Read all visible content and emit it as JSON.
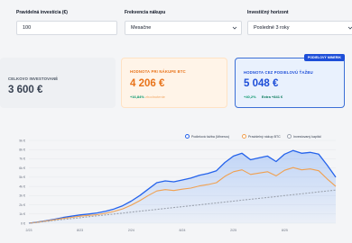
{
  "controls": {
    "investment": {
      "label": "Pravidelná investícia (€)",
      "value": "100"
    },
    "frequency": {
      "label": "Frekvencia nákupu",
      "value": "Mesačne"
    },
    "period": {
      "label": "Investičný horizont",
      "value": "Posledné 3 roky"
    }
  },
  "cards": {
    "total": {
      "title": "CELKOVO INVESTOVANÉ",
      "value": "3 600 €"
    },
    "btc": {
      "title": "HODNOTA PRI NÁKUPE BTC",
      "value": "4 206 €",
      "change": "+16,84%",
      "note": "zhodnotenie"
    },
    "mining": {
      "title": "HODNOTA CEZ PODIELOVÚ ŤAŽBU",
      "badge": "PODIELOVÝ MINERIK",
      "value": "5 048 €",
      "change": "+40,2%",
      "extra": "Extra +841 €"
    }
  },
  "chart_data": {
    "type": "line",
    "x_tick_labels": [
      "2/23",
      "8/23",
      "2/24",
      "8/24",
      "2/25",
      "8/25"
    ],
    "y_tick_labels": [
      "0 €",
      "1k €",
      "2k €",
      "3k €",
      "4k €",
      "5k €",
      "6k €",
      "7k €",
      "8k €",
      "9k €"
    ],
    "ylim": [
      0,
      9000
    ],
    "grid": true,
    "legend_position": "top-right",
    "x_months": [
      0,
      1,
      2,
      3,
      4,
      5,
      6,
      7,
      8,
      9,
      10,
      11,
      12,
      13,
      14,
      15,
      16,
      17,
      18,
      19,
      20,
      21,
      22,
      23,
      24,
      25,
      26,
      27,
      28,
      29,
      30,
      31,
      32,
      33,
      34,
      35,
      36
    ],
    "series": [
      {
        "name": "Podielová ťažba (Minerus)",
        "color": "#2563eb",
        "fill": true,
        "values": [
          0,
          120,
          260,
          430,
          620,
          760,
          900,
          1000,
          1120,
          1300,
          1550,
          1900,
          2400,
          3000,
          3700,
          4400,
          4600,
          4500,
          4700,
          4900,
          5200,
          5400,
          5700,
          6600,
          7300,
          7600,
          6900,
          7100,
          7300,
          6700,
          7500,
          7900,
          7600,
          7700,
          7500,
          6300,
          5000
        ]
      },
      {
        "name": "Pravidelný nákup BTC",
        "color": "#f0a050",
        "fill": false,
        "values": [
          0,
          110,
          230,
          370,
          520,
          640,
          760,
          850,
          930,
          1080,
          1280,
          1560,
          1960,
          2450,
          3000,
          3500,
          3650,
          3550,
          3700,
          3820,
          4050,
          4200,
          4400,
          5100,
          5600,
          5800,
          5300,
          5450,
          5600,
          5150,
          5750,
          6050,
          5800,
          5900,
          5700,
          4800,
          4000
        ]
      },
      {
        "name": "Investovaný kapitál",
        "color": "#9ca3af",
        "fill": false,
        "dashed": true,
        "values": [
          0,
          100,
          200,
          300,
          400,
          500,
          600,
          700,
          800,
          900,
          1000,
          1100,
          1200,
          1300,
          1400,
          1500,
          1600,
          1700,
          1800,
          1900,
          2000,
          2100,
          2200,
          2300,
          2400,
          2500,
          2600,
          2700,
          2800,
          2900,
          3000,
          3100,
          3200,
          3300,
          3400,
          3500,
          3600
        ]
      }
    ]
  }
}
